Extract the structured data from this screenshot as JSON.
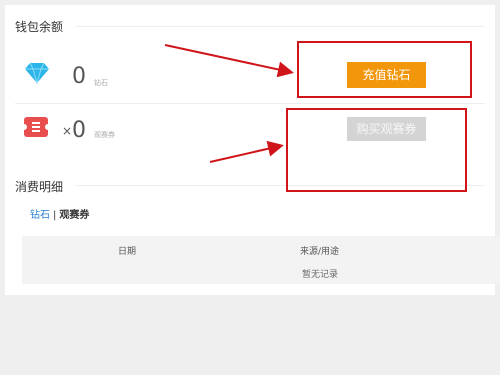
{
  "wallet": {
    "title": "钱包余额",
    "diamond": {
      "icon": "diamond-icon",
      "count": "0",
      "unit": "钻石",
      "button_label": "充值钻石"
    },
    "ticket": {
      "icon": "ticket-icon",
      "prefix": "×",
      "count": "0",
      "unit": "观赛券",
      "button_label": "购买观赛券"
    }
  },
  "details": {
    "title": "消费明细",
    "tabs": [
      {
        "label": "钻石",
        "active": true
      },
      {
        "label": "观赛券",
        "active": false
      }
    ],
    "tab_separator": "|",
    "columns": [
      "日期",
      "来源/用途"
    ],
    "empty_text": "暂无记录"
  },
  "colors": {
    "recharge_button": "#f2960b",
    "disabled_button": "#d4d4d4",
    "annotation_red": "#d0151a",
    "tab_active": "#2a7fd4",
    "diamond": "#2bb5e8",
    "ticket": "#e84e4e"
  }
}
